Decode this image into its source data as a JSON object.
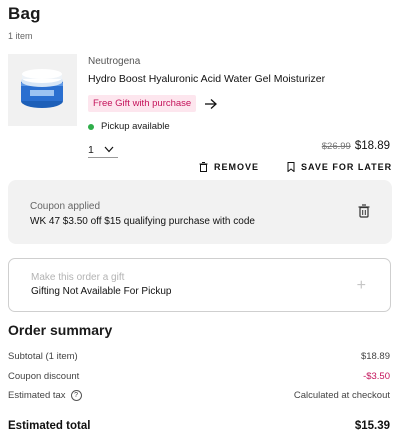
{
  "header": {
    "title": "Bag",
    "item_count": "1 item"
  },
  "product": {
    "brand": "Neutrogena",
    "name": "Hydro Boost Hyaluronic Acid Water Gel Moisturizer",
    "gift_badge": "Free Gift with purchase",
    "pickup": "Pickup available",
    "quantity": "1",
    "old_price": "$26.99",
    "price": "$18.89"
  },
  "actions": {
    "remove": "REMOVE",
    "save_for_later": "SAVE FOR LATER"
  },
  "coupon": {
    "label": "Coupon applied",
    "text": "WK 47 $3.50 off $15 qualifying purchase with code"
  },
  "gift_option": {
    "hint": "Make this order a gift",
    "text": "Gifting Not Available For Pickup"
  },
  "summary": {
    "title": "Order summary",
    "subtotal_label": "Subtotal (1 item)",
    "subtotal_value": "$18.89",
    "discount_label": "Coupon discount",
    "discount_value": "-$3.50",
    "tax_label": "Estimated tax",
    "tax_value": "Calculated at checkout",
    "total_label": "Estimated total",
    "total_value": "$15.39"
  },
  "colors": {
    "accent_pink": "#c4125a",
    "pickup_green": "#2fae4a",
    "jar_blue": "#2a6fd0"
  },
  "icons": [
    "arrow-right-icon",
    "chevron-down-icon",
    "trash-icon",
    "bookmark-icon",
    "plus-icon",
    "info-icon"
  ]
}
